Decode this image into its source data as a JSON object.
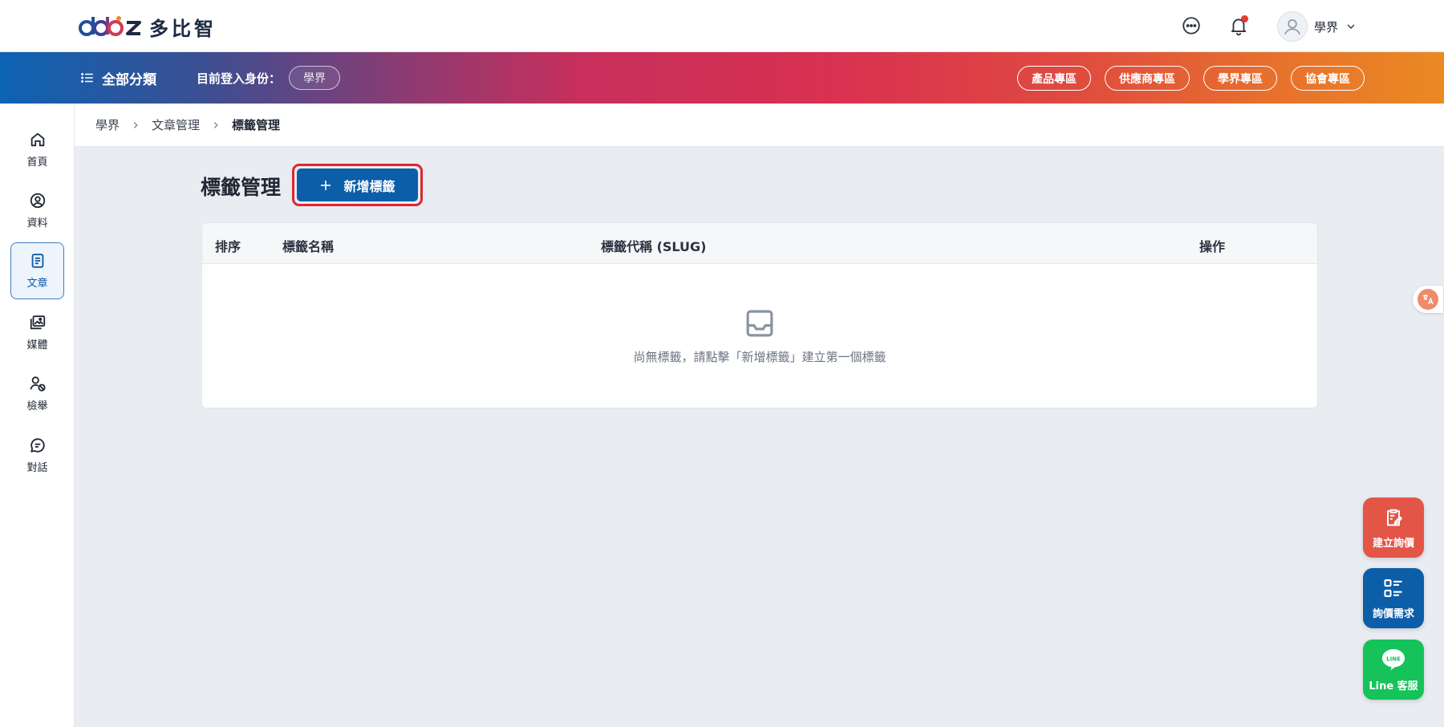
{
  "header": {
    "logo_text": "多比智",
    "user_name": "學界"
  },
  "nav": {
    "all_categories": "全部分類",
    "login_as_label": "目前登入身份：",
    "role": "學界",
    "zones": [
      "產品專區",
      "供應商專區",
      "學界專區",
      "協會專區"
    ]
  },
  "sidebar": {
    "items": [
      {
        "label": "首頁",
        "icon": "home-icon"
      },
      {
        "label": "資料",
        "icon": "user-circle-icon"
      },
      {
        "label": "文章",
        "icon": "document-icon",
        "active": true
      },
      {
        "label": "媒體",
        "icon": "images-icon"
      },
      {
        "label": "檢舉",
        "icon": "user-block-icon"
      },
      {
        "label": "對話",
        "icon": "chat-icon"
      }
    ]
  },
  "breadcrumb": [
    "學界",
    "文章管理",
    "標籤管理"
  ],
  "main": {
    "title": "標籤管理",
    "add_button": "新增標籤",
    "table": {
      "columns": [
        "排序",
        "標籤名稱",
        "標籤代稱 (SLUG)",
        "操作"
      ],
      "empty_text": "尚無標籤，請點擊「新增標籤」建立第一個標籤"
    }
  },
  "fabs": {
    "quote": "建立詢價",
    "needs": "詢價需求",
    "line": "Line 客服",
    "line_badge": "LINE"
  },
  "colors": {
    "primary": "#0d5ea8",
    "highlight_border": "#e0252f",
    "fab_quote": "#e35547",
    "fab_line": "#15c35a"
  }
}
